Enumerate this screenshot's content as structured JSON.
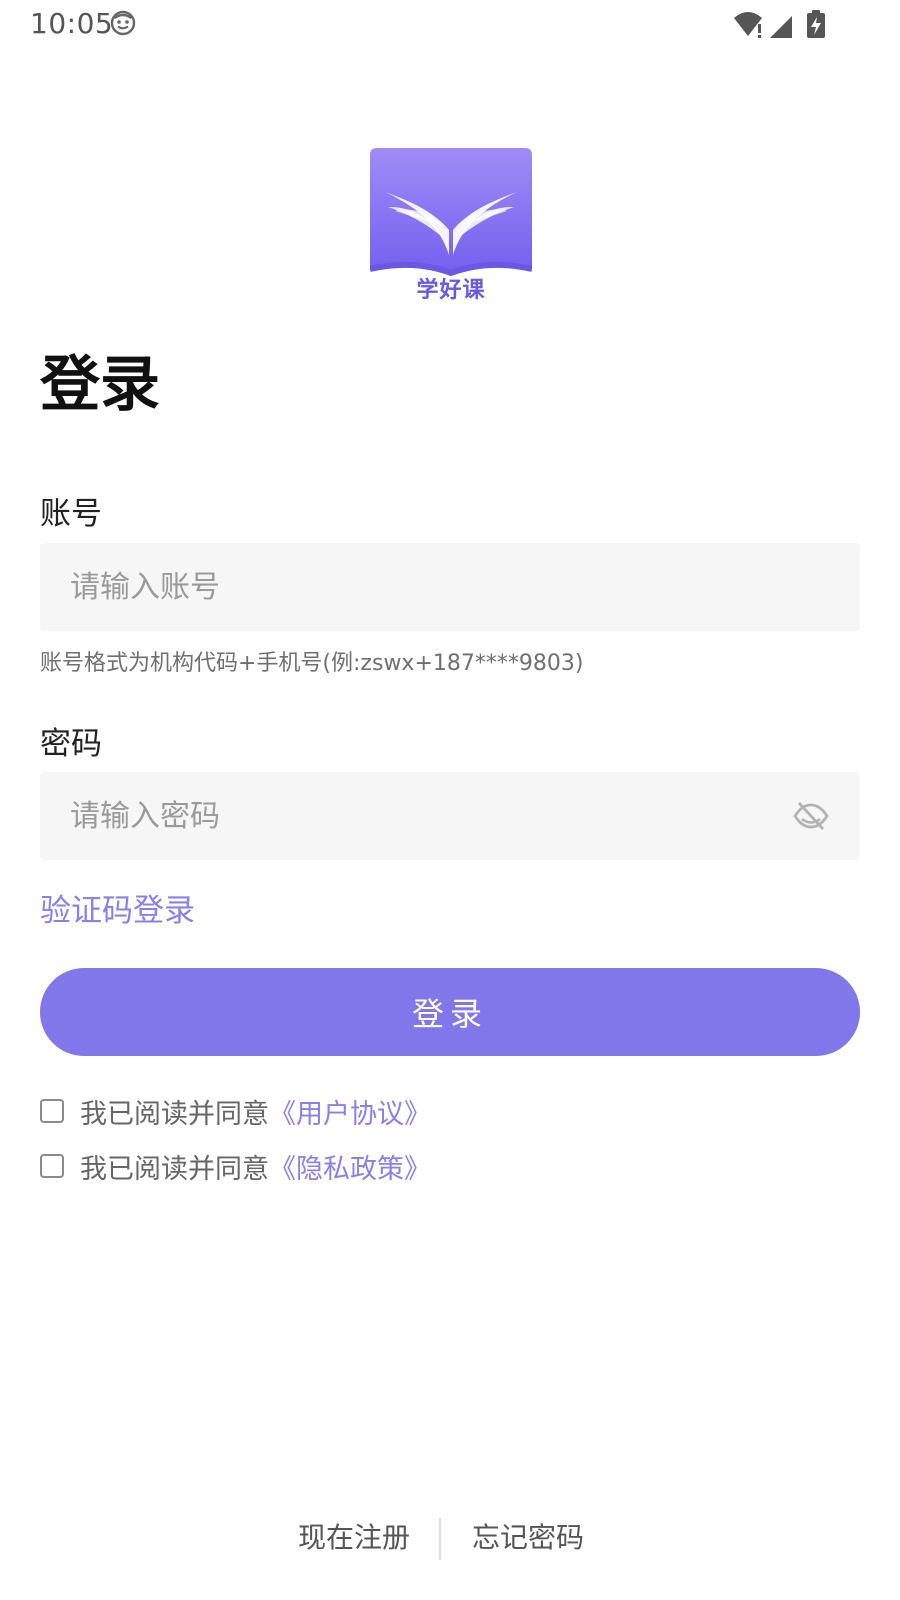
{
  "status_bar": {
    "time": "10:05",
    "icons": [
      "face-icon",
      "wifi-icon",
      "signal-icon",
      "battery-charging-icon"
    ]
  },
  "logo": {
    "text": "学好课",
    "colors": {
      "top": "#9f8cf7",
      "bottom": "#7560ef",
      "text": "#6a57e6"
    }
  },
  "page": {
    "title": "登录"
  },
  "account": {
    "label": "账号",
    "placeholder": "请输入账号",
    "value": "",
    "hint": "账号格式为机构代码+手机号(例:zswx+187****9803)"
  },
  "password": {
    "label": "密码",
    "placeholder": "请输入密码",
    "value": "",
    "toggle_icon": "eye-off-icon"
  },
  "actions": {
    "sms_login": "验证码登录",
    "login_button": "登录"
  },
  "agreements": [
    {
      "prefix": "我已阅读并同意",
      "link": "《用户协议》",
      "checked": false
    },
    {
      "prefix": "我已阅读并同意",
      "link": "《隐私政策》",
      "checked": false
    }
  ],
  "footer": {
    "register": "现在注册",
    "forgot_password": "忘记密码"
  },
  "theme": {
    "accent": "#8277ea",
    "link": "#8a7ff0",
    "input_background": "#f6f6f6"
  }
}
